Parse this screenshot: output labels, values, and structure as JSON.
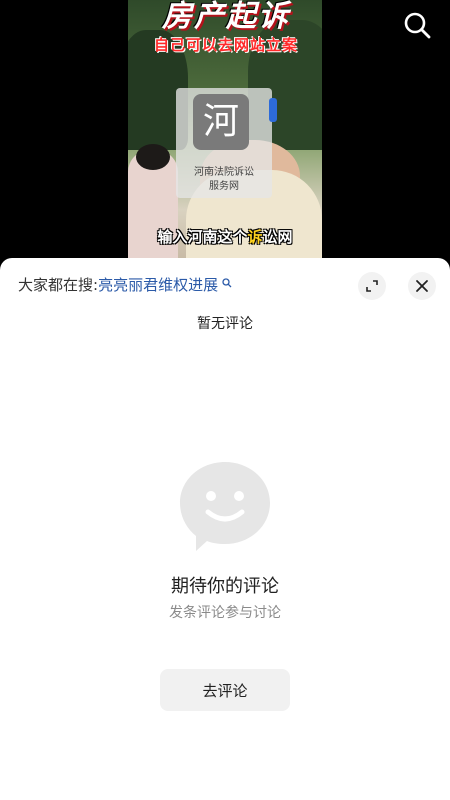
{
  "video": {
    "title": "房产起诉",
    "subtitle": "自己可以去网站立案",
    "logo_char": "河",
    "logo_caption_line1": "河南法院诉讼",
    "logo_caption_line2": "服务网",
    "caption_before": "输入河南这个",
    "caption_highlight": "诉",
    "caption_after": "讼网"
  },
  "comment_sheet": {
    "hot_search_label": "大家都在搜:",
    "hot_search_term": "亮亮丽君维权进展",
    "no_comments_text": "暂无评论",
    "empty_title": "期待你的评论",
    "empty_subtitle": "发条评论参与讨论",
    "go_comment_label": "去评论"
  },
  "colors": {
    "link_blue": "#2b5aa8",
    "caption_highlight": "#ffd21f",
    "subtitle_red": "#ff2a2a"
  },
  "icons": {
    "search": "search-icon",
    "expand": "expand-icon",
    "close": "close-icon",
    "empty_state": "smiley-chat-bubble-icon"
  }
}
